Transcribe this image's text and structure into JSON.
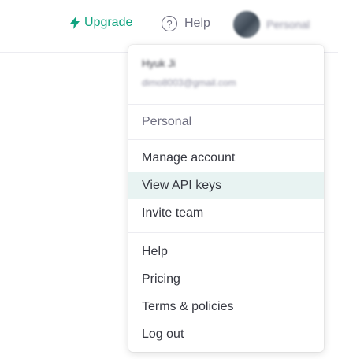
{
  "topbar": {
    "upgrade_label": "Upgrade",
    "help_label": "Help",
    "account_label": "Personal"
  },
  "menu": {
    "user_name": "Hyuk Ji",
    "user_email": "dimo8003@gmail.com",
    "org_label": "Personal",
    "section1": [
      "Manage account",
      "View API keys",
      "Invite team"
    ],
    "section2": [
      "Help",
      "Pricing",
      "Terms & policies",
      "Log out"
    ],
    "highlighted_item": "View API keys"
  },
  "colors": {
    "accent": "#10a37f",
    "highlight_bg": "#e8f3f2",
    "text": "#353740",
    "muted": "#6e6e80",
    "divider": "#ececf1"
  },
  "icons": {
    "upgrade": "lightning-bolt-icon",
    "help": "question-circle-icon",
    "avatar": "avatar"
  }
}
